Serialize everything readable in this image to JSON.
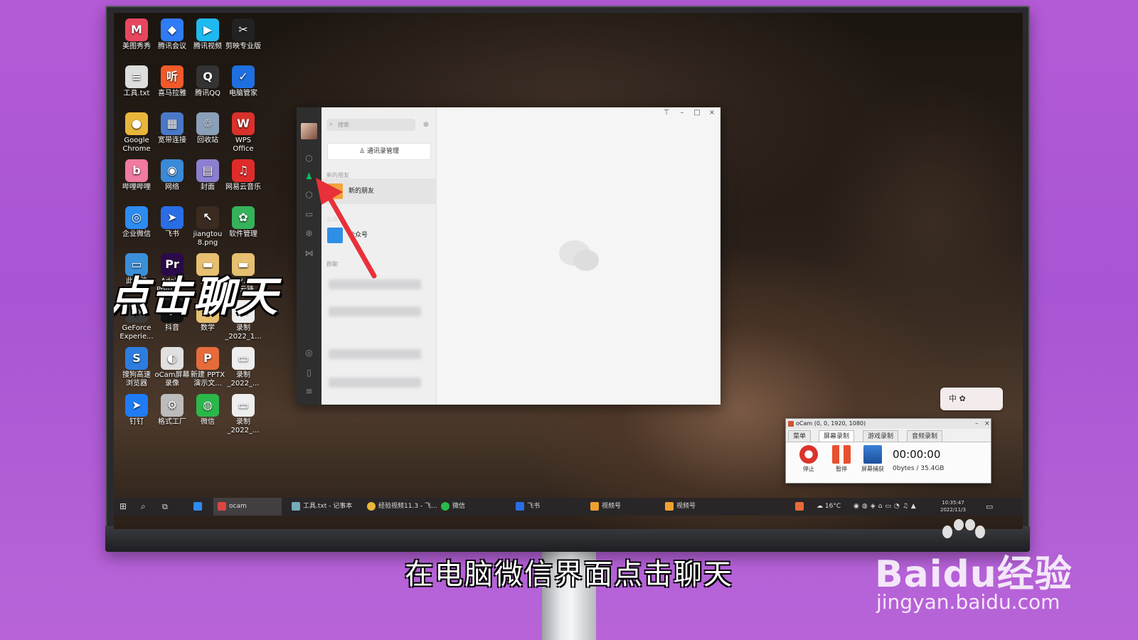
{
  "desktop_icons": [
    {
      "label": "美图秀秀",
      "color": "#e8465f",
      "glyph": "M"
    },
    {
      "label": "腾讯会议",
      "color": "#2f7cf6",
      "glyph": "◆"
    },
    {
      "label": "腾讯视频",
      "color": "#1fb9f1",
      "glyph": "▶"
    },
    {
      "label": "剪映专业版",
      "color": "#222222",
      "glyph": "✂"
    },
    {
      "label": "工具.txt",
      "color": "#dddddd",
      "glyph": "≡"
    },
    {
      "label": "喜马拉雅",
      "color": "#f25a29",
      "glyph": "听"
    },
    {
      "label": "腾讯QQ",
      "color": "#333333",
      "glyph": "Q"
    },
    {
      "label": "电脑管家",
      "color": "#1e6fe0",
      "glyph": "✓"
    },
    {
      "label": "Google Chrome",
      "color": "#e8b63b",
      "glyph": "●"
    },
    {
      "label": "宽带连接",
      "color": "#4a78c8",
      "glyph": "▦"
    },
    {
      "label": "回收站",
      "color": "#8aa0b8",
      "glyph": "♲"
    },
    {
      "label": "WPS Office",
      "color": "#d9312b",
      "glyph": "W"
    },
    {
      "label": "哔哩哔哩",
      "color": "#f07aa0",
      "glyph": "b"
    },
    {
      "label": "网络",
      "color": "#3a8ad8",
      "glyph": "◉"
    },
    {
      "label": "封面",
      "color": "#8b7fd0",
      "glyph": "▤"
    },
    {
      "label": "网易云音乐",
      "color": "#e02b2b",
      "glyph": "♫"
    },
    {
      "label": "企业微信",
      "color": "#2d8cf0",
      "glyph": "◎"
    },
    {
      "label": "飞书",
      "color": "#2a6ee6",
      "glyph": "➤"
    },
    {
      "label": "jiangtou 8.png",
      "color": "#3a2a20",
      "glyph": "↖"
    },
    {
      "label": "软件管理",
      "color": "#34b35a",
      "glyph": "✿"
    },
    {
      "label": "此电脑",
      "color": "#3b8fd8",
      "glyph": "▭"
    },
    {
      "label": "Adobe Premie...",
      "color": "#2a0a4a",
      "glyph": "Pr"
    },
    {
      "label": "英语",
      "color": "#e6c070",
      "glyph": "▬"
    },
    {
      "label": "2022.11... 杨云锋",
      "color": "#e6c070",
      "glyph": "▬"
    },
    {
      "label": "GeForce Experie...",
      "color": "#3a3a3a",
      "glyph": "◈"
    },
    {
      "label": "抖音",
      "color": "#111111",
      "glyph": "♪"
    },
    {
      "label": "数学",
      "color": "#e6c070",
      "glyph": "▬"
    },
    {
      "label": "录制 _2022_1...",
      "color": "#eeeeee",
      "glyph": "▭"
    },
    {
      "label": "搜狗高速 浏览器",
      "color": "#2d7de0",
      "glyph": "S"
    },
    {
      "label": "oCam屏幕 录像",
      "color": "#e0e0e0",
      "glyph": "◐"
    },
    {
      "label": "新建 PPTX 演示文...",
      "color": "#e66b3b",
      "glyph": "P"
    },
    {
      "label": "录制 _2022_...",
      "color": "#eeeeee",
      "glyph": "▭"
    },
    {
      "label": "钉钉",
      "color": "#1f7cf5",
      "glyph": "➤"
    },
    {
      "label": "格式工厂",
      "color": "#bcbcbc",
      "glyph": "⚙"
    },
    {
      "label": "微信",
      "color": "#2bb84a",
      "glyph": "◍"
    },
    {
      "label": "录制 _2022_...",
      "color": "#eeeeee",
      "glyph": "▭"
    }
  ],
  "overlay_text": "点击聊天",
  "wechat": {
    "search_placeholder": "搜索",
    "manage_button": "通讯录管理",
    "section_new_friends": "新的朋友",
    "new_friends_item": "新的朋友",
    "section_official": "公众号",
    "official_item": "公众号",
    "section_groups": "群聊",
    "icons": {
      "chat": "chat-bubble-icon",
      "contacts": "contacts-icon",
      "favorites": "cube-icon",
      "files": "folder-icon",
      "moments": "aperture-icon",
      "channels": "channels-icon",
      "mini": "compass-icon",
      "phone": "phone-icon",
      "settings": "menu-icon"
    },
    "accent": "#07c160"
  },
  "ocam": {
    "title": "oCam (0, 0, 1920, 1080)",
    "tabs": [
      "菜单",
      "屏幕录制",
      "游戏录制",
      "音频录制"
    ],
    "active_tab": "屏幕录制",
    "buttons": [
      "停止",
      "暂停",
      "屏幕捕获"
    ],
    "time": "00:00:00",
    "size": "0bytes / 35.4GB",
    "float_label": "中"
  },
  "taskbar": {
    "items": [
      "ocam",
      "工具.txt - 记事本",
      "经验视频11.3 - 飞...",
      "微信",
      "飞书",
      "视频号",
      "视频号"
    ],
    "weather": "16°C",
    "clock_time": "10:35:47",
    "clock_date": "2022/11/3"
  },
  "caption": "在电脑微信界面点击聊天",
  "watermark": {
    "brand": "Baidu经验",
    "url": "jingyan.baidu.com"
  }
}
